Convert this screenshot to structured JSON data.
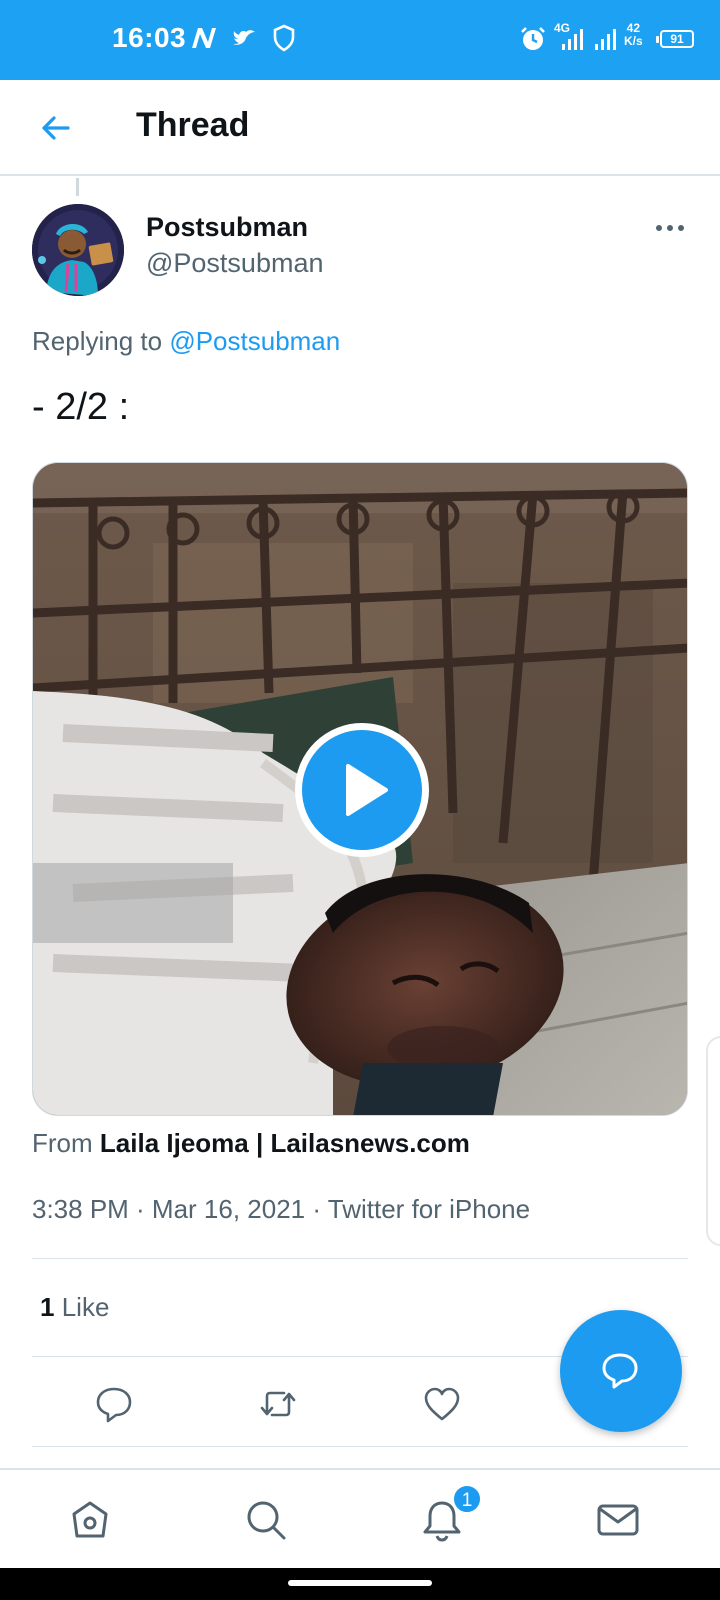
{
  "status_bar": {
    "time": "16:03",
    "network_type": "4G",
    "speed_value": "42",
    "speed_unit": "K/s",
    "battery": "91"
  },
  "header": {
    "title": "Thread"
  },
  "tweet": {
    "author_name": "Postsubman",
    "author_handle": "@Postsubman",
    "replying_prefix": "Replying to",
    "replying_to": "@Postsubman",
    "text": "- 2/2 :",
    "source_prefix": "From",
    "source_name": "Laila Ijeoma | Lailasnews.com",
    "timestamp": "3:38 PM · Mar 16, 2021 · Twitter for iPhone",
    "like_count": "1",
    "like_label": "Like"
  },
  "actions": {
    "reply_icon": "reply-icon",
    "retweet_icon": "retweet-icon",
    "like_icon": "heart-icon",
    "compose_icon": "compose-reply-icon"
  },
  "bottom_nav": {
    "items": [
      "home-icon",
      "search-icon",
      "notifications-icon",
      "messages-icon"
    ],
    "notification_badge": "1"
  },
  "colors": {
    "accent": "#1d9bf0",
    "status_bar": "#1da1f2",
    "secondary_text": "#536471"
  }
}
